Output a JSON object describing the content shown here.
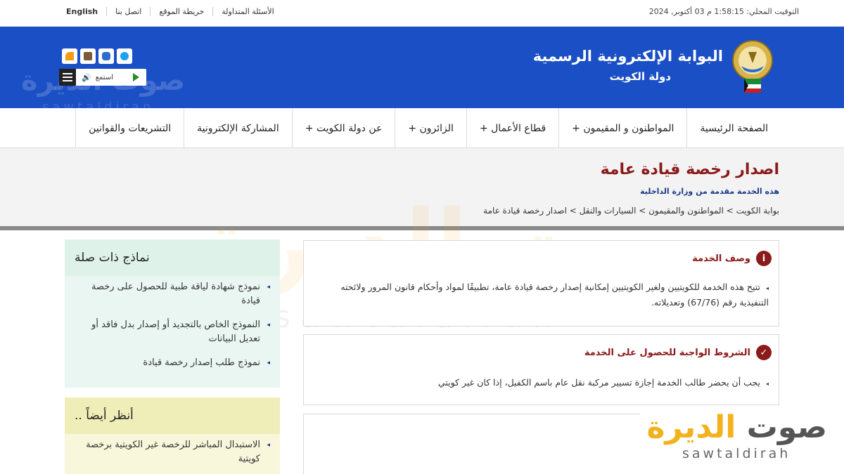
{
  "topbar": {
    "local_time": "التوقيت المحلي: 1:58:15 م 03 أكتوبر, 2024",
    "links": [
      "English",
      "اتصل بنا",
      "خريطة الموقع",
      "الأسئلة المتداولة"
    ]
  },
  "header": {
    "portal_title": "البوابة الإلكترونية الرسمية",
    "portal_subtitle": "دولة الكويت",
    "listen_label": "استمع",
    "watermark_text": "صوت الديرة",
    "watermark_sub": "sawtaldiran"
  },
  "nav": {
    "items": [
      "الصفحة الرئيسية",
      "المواطنون و المقيمون +",
      "قطاع الأعمال +",
      "الزائرون +",
      "عن دولة الكويت +",
      "المشاركة الإلكترونية",
      "التشريعات والقوانين"
    ]
  },
  "page": {
    "title": "اصدار رخصة قيادة عامة",
    "provider": "هذه الخدمة مقدمة من وزارة الداخلية",
    "breadcrumb": "بوابة الكويت > المواطنون والمقيمون > السيارات والنقل > اصدار رخصة قيادة عامة"
  },
  "service_description": {
    "title": "وصف الخدمة",
    "badge": "i",
    "text": "تتيح هذه الخدمة للكويتيين ولغير الكويتيين إمكانية إصدار رخصة قيادة عامة، تطبيقًا لمواد وأحكام قانون المرور ولائحته التنفيذية رقم (67/76) وتعديلاته."
  },
  "requirements": {
    "title": "الشروط الواجبة للحصول على الخدمة",
    "badge": "✓",
    "text": "يجب أن يحضر طالب الخدمة إجازة تسيير مركبة نقل عام باسم الكفيل، إذا كان غير كويتي"
  },
  "related_forms": {
    "title": "نماذج ذات صلة",
    "items": [
      "نموذج شهادة لياقة طبية للحصول على رخصة قيادة",
      "النموذج الخاص بالتجديد أو إصدار بدل فاقد أو تعديل البيانات",
      "نموذج طلب إصدار رخصة قيادة"
    ]
  },
  "see_also": {
    "title": "أنظر أيضاً ..",
    "items": [
      "الاستبدال المباشر للرخصة غير الكويتية برخصة كويتية"
    ]
  },
  "brand": {
    "part1": "صوت",
    "part2": "الديرة",
    "sub": "sawtaldirah"
  },
  "colors": {
    "header_blue": "#1a4fc6",
    "title_red": "#8b1a1a",
    "green_panel": "#e9f6f1",
    "yellow_panel": "#f8f7dc",
    "brand_orange": "#f2b21d"
  }
}
